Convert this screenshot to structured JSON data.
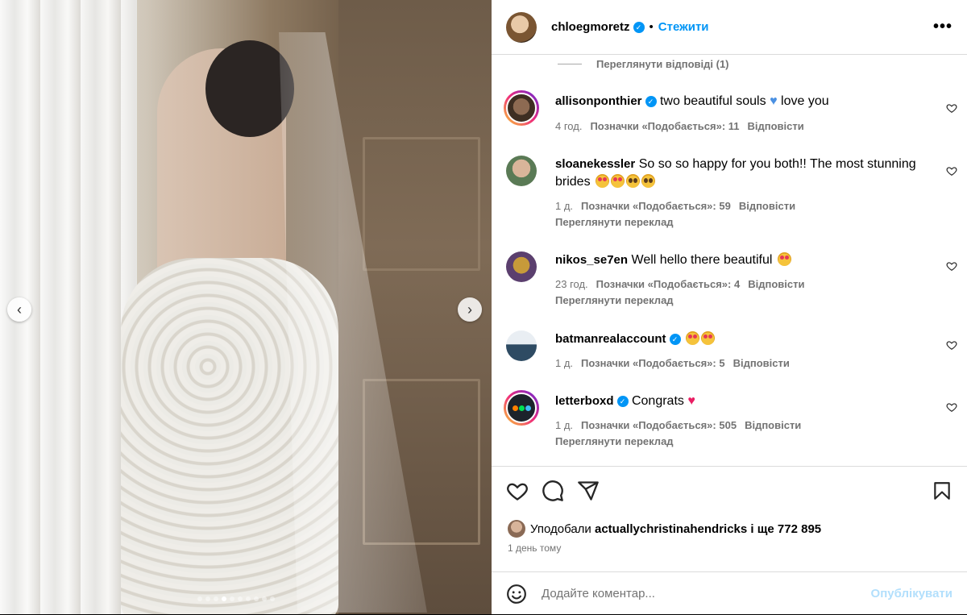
{
  "post": {
    "author": "chloegmoretz",
    "follow_label": "Стежити",
    "separator": "•",
    "more_label": "•••"
  },
  "media": {
    "prev_glyph": "‹",
    "next_glyph": "›",
    "dot_count": 10,
    "active_dot": 3
  },
  "comments": {
    "view_replies": "Переглянути відповіді (1)",
    "items": [
      {
        "username": "allisonponthier",
        "verified": true,
        "text": "two beautiful souls",
        "text_after": "love you",
        "time": "4 год.",
        "likes": "Позначки «Подобається»: 11",
        "reply": "Відповісти"
      },
      {
        "username": "sloanekessler",
        "verified": false,
        "text": "So so so happy for you both!! The most stunning brides",
        "time": "1 д.",
        "likes": "Позначки «Подобається»: 59",
        "reply": "Відповісти",
        "translate": "Переглянути переклад"
      },
      {
        "username": "nikos_se7en",
        "verified": false,
        "text": "Well hello there beautiful",
        "time": "23 год.",
        "likes": "Позначки «Подобається»: 4",
        "reply": "Відповісти",
        "translate": "Переглянути переклад"
      },
      {
        "username": "batmanrealaccount",
        "verified": true,
        "text": "",
        "time": "1 д.",
        "likes": "Позначки «Подобається»: 5",
        "reply": "Відповісти"
      },
      {
        "username": "letterboxd",
        "verified": true,
        "text": "Congrats",
        "time": "1 д.",
        "likes": "Позначки «Подобається»: 505",
        "reply": "Відповісти",
        "translate": "Переглянути переклад"
      }
    ]
  },
  "likes_summary": {
    "prefix": "Уподобали",
    "user": "actuallychristinahendricks",
    "suffix": "і ще 772 895"
  },
  "posted_time": "1 день тому",
  "add_comment": {
    "placeholder": "Додайте коментар...",
    "post_label": "Опублікувати"
  },
  "icons": {
    "like": "heart-icon",
    "comment": "comment-icon",
    "share": "share-icon",
    "save": "bookmark-icon",
    "emoji": "emoji-icon"
  }
}
